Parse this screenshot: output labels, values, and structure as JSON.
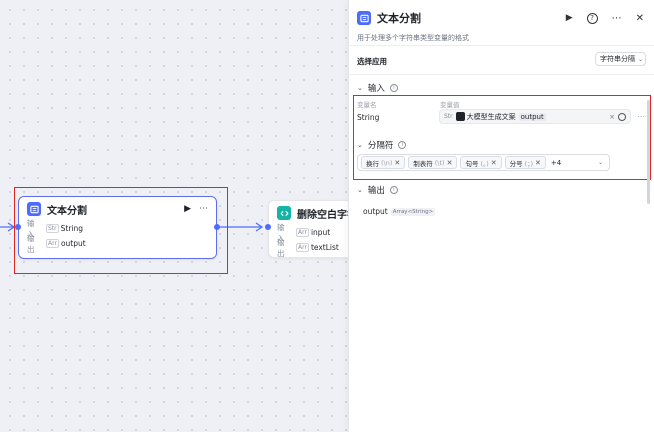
{
  "canvas": {
    "node_text_split": {
      "title": "文本分割",
      "input_label": "输入",
      "input_type": "Str",
      "input_value": "String",
      "output_label": "输出",
      "output_type": "Arr",
      "output_value": "output"
    },
    "node_remove_chars": {
      "title": "删除空白字符",
      "input_label": "输入",
      "input_type": "Arr",
      "input_value": "input",
      "output_label": "输出",
      "output_type": "Arr",
      "output_value": "textList"
    }
  },
  "panel": {
    "title": "文本分割",
    "description": "用于处理多个字符串类型变量的格式",
    "select_app_label": "选择应用",
    "select_app_value": "字符串分隔",
    "input_section": {
      "title": "输入",
      "col_var_name": "变量名",
      "col_var_value": "变量值",
      "var_name": "String",
      "var_type": "Str",
      "source_node": "大模型生成文案",
      "source_field": "output"
    },
    "delimiter_section": {
      "title": "分隔符",
      "chips": [
        {
          "label": "换行",
          "delim": "(\\n)"
        },
        {
          "label": "制表符",
          "delim": "(\\t)"
        },
        {
          "label": "句号",
          "delim": "(。)"
        },
        {
          "label": "分号",
          "delim": "(；)"
        }
      ],
      "more": "+4"
    },
    "output_section": {
      "title": "输出",
      "var_name": "output",
      "var_type": "Array<String>"
    }
  },
  "colors": {
    "accent": "#4d6bfe",
    "highlight": "#e02424",
    "teal": "#16b4a6"
  }
}
